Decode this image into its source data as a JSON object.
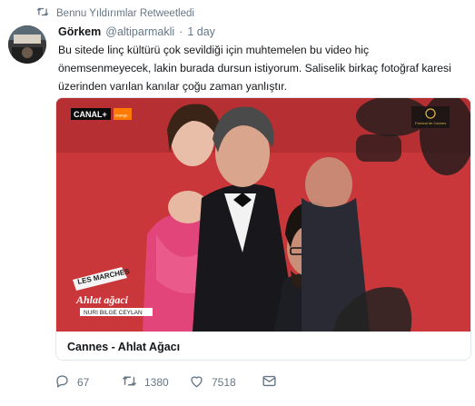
{
  "retweet_notice": "Bennu Yıldırımlar Retweetledi",
  "tweet": {
    "author_name": "Görkem",
    "handle": "@altiparmakli",
    "separator": "·",
    "time": "1 day",
    "text_lines": [
      "Bu sitede linç kültürü çok sevildiği için muhtemelen bu video hiç",
      "önemsenmeyecek, lakin burada dursun istiyorum. Saliselik birkaç fotoğraf karesi",
      "üzerinden varılan kanılar çoğu zaman yanlıştır."
    ]
  },
  "card": {
    "title": "Cannes - Ahlat Ağacı",
    "overlay": {
      "channel_logo": "CANAL+",
      "channel_sub": "orange",
      "festival_logo": "Festival de Cannes",
      "banner_small": "LES MARCHES",
      "banner_title": "Ahlat ağaci",
      "banner_director": "NURI BILGE CEYLAN"
    }
  },
  "actions": {
    "replies": "67",
    "retweets": "1380",
    "likes": "7518"
  },
  "colors": {
    "muted": "#657786",
    "carpet_red": "#c9373a",
    "text": "#14171a"
  }
}
